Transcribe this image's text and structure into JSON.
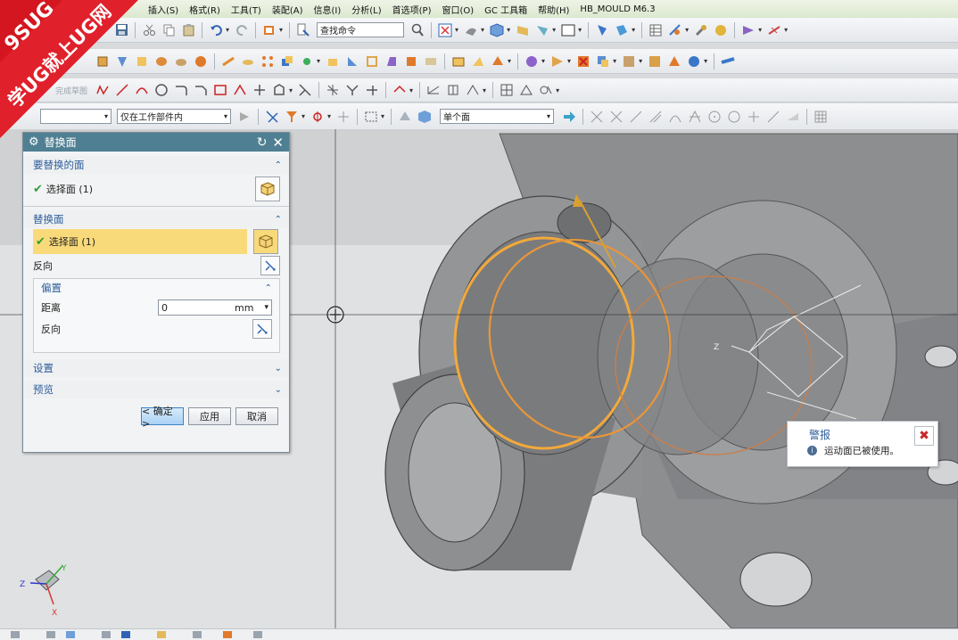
{
  "menubar": {
    "items": [
      "插入(S)",
      "格式(R)",
      "工具(T)",
      "装配(A)",
      "信息(I)",
      "分析(L)",
      "首选项(P)",
      "窗口(O)",
      "GC 工具箱",
      "帮助(H)",
      "HB_MOULD M6.3"
    ]
  },
  "toolbar": {
    "search_value": "查找命令",
    "filter_value": "仅在工作部件内",
    "face_rule_value": "单个面",
    "sketch_finish_label": "完成草图"
  },
  "dialog": {
    "title": "替换面",
    "sections": {
      "faces_to_replace": {
        "header": "要替换的面",
        "select_label": "选择面 (1)"
      },
      "replacement_face": {
        "header": "替换面",
        "select_label": "选择面 (1)",
        "reverse_label": "反向"
      },
      "offset": {
        "header": "偏置",
        "distance_label": "距离",
        "distance_value": "0",
        "distance_unit": "mm",
        "reverse_label": "反向"
      },
      "settings": {
        "header": "设置"
      },
      "preview": {
        "header": "预览"
      }
    },
    "buttons": {
      "ok": "< 确定 >",
      "apply": "应用",
      "cancel": "取消"
    }
  },
  "alert": {
    "title": "警报",
    "message": "运动面已被使用。"
  },
  "viewport": {
    "axis_label_z": "Z",
    "triad": {
      "x": "X",
      "y": "Y",
      "z": "Z"
    }
  },
  "watermark": {
    "line1": "9SUG",
    "line2": "学UG就上UG网"
  },
  "colors": {
    "dialog_title_bg": "#4f7f92",
    "section_header_text": "#2c5d99",
    "selected_row_bg": "#f9da7a",
    "check_green": "#2e9e36",
    "highlight_curve": "#f2a93b",
    "watermark_red": "#e0202a",
    "alert_close_red": "#c62828"
  }
}
